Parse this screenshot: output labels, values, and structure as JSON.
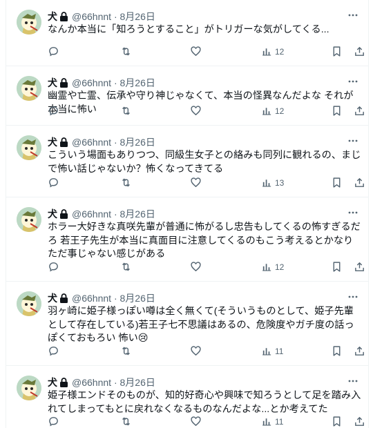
{
  "author": {
    "name": "犬",
    "handle": "@66hnnt",
    "separator": "·"
  },
  "tweets": [
    {
      "date": "8月26日",
      "text": "なんか本当に「知ろうとすること」がトリガーな気がしてくる...",
      "views": "12"
    },
    {
      "date": "8月26日",
      "text": "幽霊や亡霊、伝承や守り神じゃなくて、本当の怪異なんだよな それが本当に怖い",
      "views": "12"
    },
    {
      "date": "8月26日",
      "text": "こういう場面もありつつ、同級生女子との絡みも同列に観れるの、まじで怖い話じゃないか？怖くなってきてる",
      "views": "13"
    },
    {
      "date": "8月26日",
      "text": "ホラー大好きな真咲先輩が普通に怖がるし忠告もしてくるの怖すぎるだろ 若王子先生が本当に真面目に注意してくるのもこう考えるとかなりただ事じゃない感じがある",
      "views": "12"
    },
    {
      "date": "8月26日",
      "text": "羽ヶ崎に姫子様っぽい噂は全く無くて(そういうものとして、姫子先輩として存在している)若王子七不思議はあるの、危険度やガチ度の話っぽくておもろい 怖い😢",
      "views": "11"
    },
    {
      "date": "8月26日",
      "text": "姫子様エンドそのものが、知的好奇心や興味で知ろうとして足を踏み入れてしまってもとに戻れなくなるものなんだよな...とか考えてた",
      "views": "11"
    }
  ],
  "icons": {
    "more": "more-icon",
    "reply": "reply-icon",
    "retweet": "retweet-icon",
    "like": "like-icon",
    "views": "views-icon",
    "bookmark": "bookmark-icon",
    "share": "share-icon",
    "lock": "lock-icon"
  },
  "colors": {
    "text": "#0f1419",
    "secondary": "#536471",
    "divider": "#eff3f4"
  }
}
